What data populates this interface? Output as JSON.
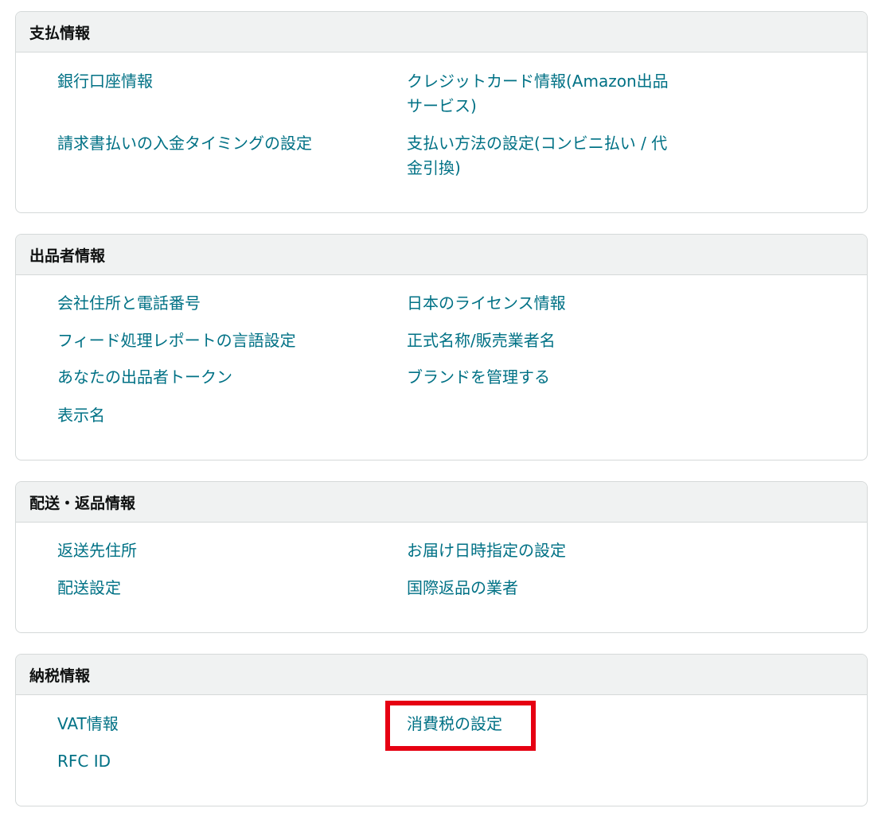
{
  "sections": [
    {
      "title": "支払情報",
      "left_links": [
        "銀行口座情報",
        "請求書払いの入金タイミングの設定"
      ],
      "right_links": [
        {
          "line1": "クレジットカード情報(Amazon出品",
          "line2": "サービス)"
        },
        {
          "line1": "支払い方法の設定(コンビニ払い / 代",
          "line2": "金引換)"
        }
      ]
    },
    {
      "title": "出品者情報",
      "left_links": [
        "会社住所と電話番号",
        "フィード処理レポートの言語設定",
        "あなたの出品者トークン",
        "表示名"
      ],
      "right_links": [
        "日本のライセンス情報",
        "正式名称/販売業者名",
        "ブランドを管理する"
      ]
    },
    {
      "title": "配送・返品情報",
      "left_links": [
        "返送先住所",
        "配送設定"
      ],
      "right_links": [
        "お届け日時指定の設定",
        "国際返品の業者"
      ]
    },
    {
      "title": "納税情報",
      "left_links": [
        "VAT情報",
        "RFC ID"
      ],
      "right_links": [
        "消費税の設定"
      ]
    }
  ],
  "colors": {
    "link": "#007185",
    "header_bg": "#f0f2f2",
    "border": "#d5d9d9",
    "highlight": "#e60012"
  }
}
